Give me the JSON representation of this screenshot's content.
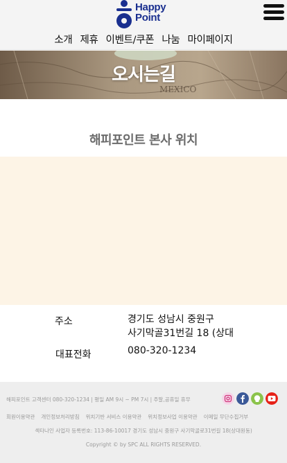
{
  "header": {
    "logo": {
      "line1": "Happy",
      "line2": "Point"
    },
    "nav": [
      {
        "label": "소개"
      },
      {
        "label": "제휴"
      },
      {
        "label": "이벤트/쿠폰"
      },
      {
        "label": "나눔"
      },
      {
        "label": "마이페이지"
      }
    ],
    "menu_icon": "hamburger-icon"
  },
  "banner": {
    "title": "오시는길"
  },
  "section": {
    "title": "해피포인트 본사 위치"
  },
  "info": {
    "address_label": "주소",
    "address_line1": "경기도 성남시 중원구",
    "address_line2": "사기막골31번길 18 (상대",
    "phone_label": "대표전화",
    "phone_value": "080-320-1234"
  },
  "footer": {
    "contact": "해피포인트 고객센터  080-320-1234  |  평일 AM 9시 ~ PM 7시  |  주말,공휴일 휴무",
    "links": [
      "회원이용약관",
      "개인정보처리방침",
      "위치기반 서비스 이용약관",
      "위치정보사업 이용약관",
      "이메일 무단수집거부"
    ],
    "registration": "섹타나인 사업자 등록번호: 113-86-10017 경기도 성남시 중원구 사기막골로31번길 18(상대원동)",
    "copyright": "Copyright © by SPC  ALL RIGHTS RESERVED.",
    "social": [
      {
        "name": "instagram-icon",
        "color": "#e1306c"
      },
      {
        "name": "facebook-icon",
        "color": "#3b5998"
      },
      {
        "name": "kakaostory-icon",
        "color": "#8bc34a"
      },
      {
        "name": "youtube-icon",
        "color": "#e62117"
      }
    ]
  },
  "colors": {
    "brand_blue": "#1a2f8f",
    "header_bg": "#f4f4f4",
    "map_bg": "#fdf4e6",
    "footer_bg": "#eeeeee"
  }
}
